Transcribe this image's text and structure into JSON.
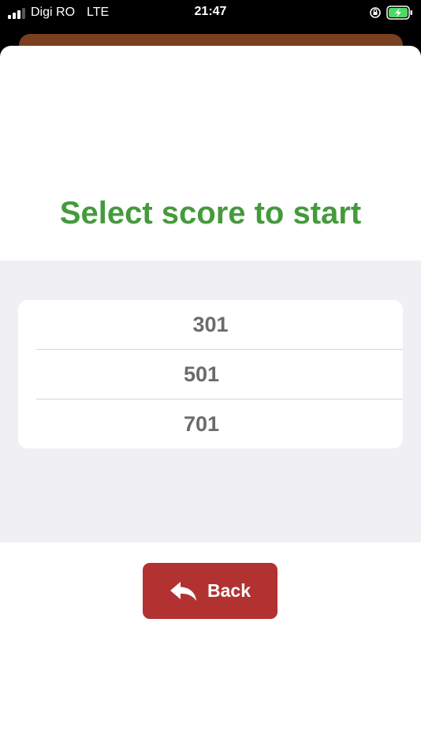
{
  "status_bar": {
    "carrier": "Digi RO",
    "network": "LTE",
    "time": "21:47"
  },
  "screen": {
    "title": "Select score to start",
    "options": [
      "301",
      "501",
      "701"
    ],
    "back_label": "Back"
  },
  "colors": {
    "title": "#459a3c",
    "back_button": "#b23232",
    "underlay": "#7a3f1e"
  }
}
